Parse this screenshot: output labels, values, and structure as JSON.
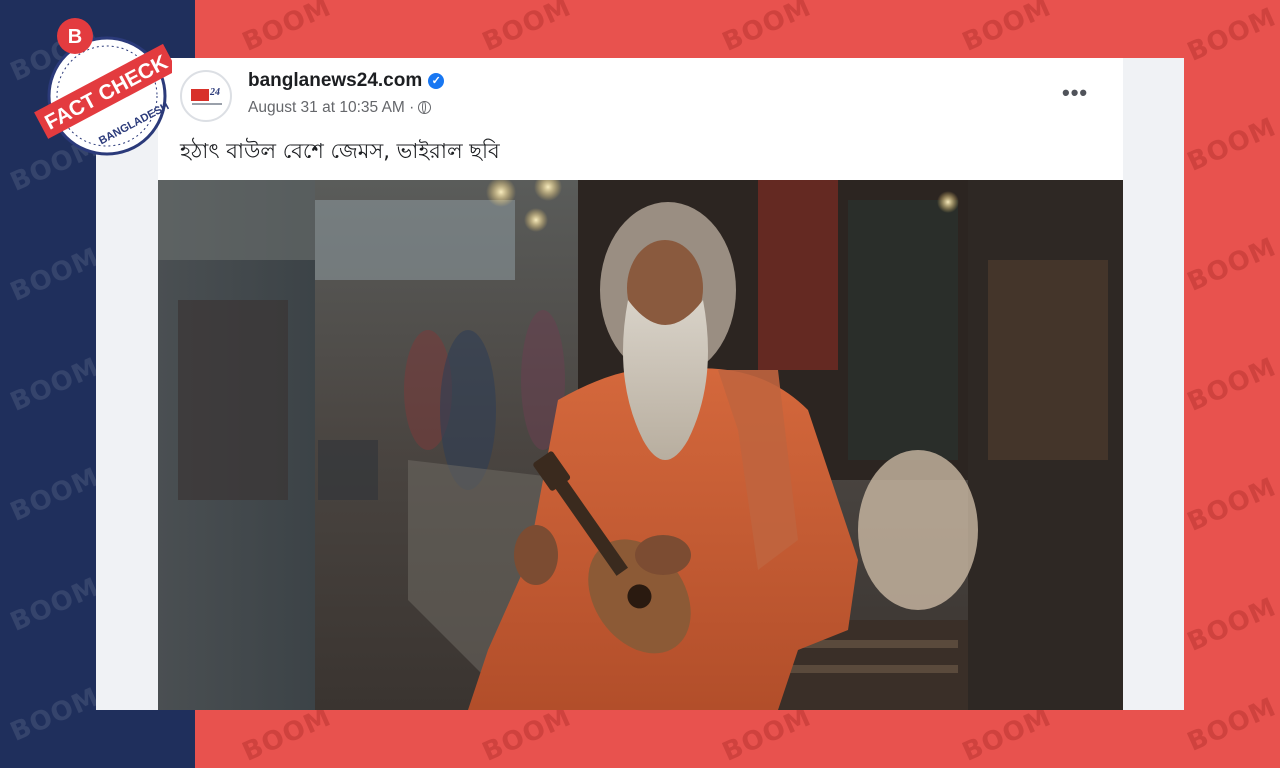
{
  "background": {
    "watermark_text": "BOOM",
    "left_band_color": "#1f2f5c",
    "right_color": "#e8524e"
  },
  "badge": {
    "letter": "B",
    "main_text": "FACT CHECK",
    "sub_text": "BANGLADESH",
    "accent_color": "#e33b3f"
  },
  "post": {
    "page_name": "banglanews24.com",
    "verified_icon": "verified-check-icon",
    "timestamp": "August 31 at 10:35 AM",
    "separator": "·",
    "privacy_icon": "globe-icon",
    "more_options_icon": "more-options-icon",
    "more_options_glyph": "•••",
    "caption": "হঠাৎ বাউল বেশে জেমস, ভাইরাল ছবি",
    "image": "photo of a bearded man in saffron clothing playing a guitar on a street"
  }
}
